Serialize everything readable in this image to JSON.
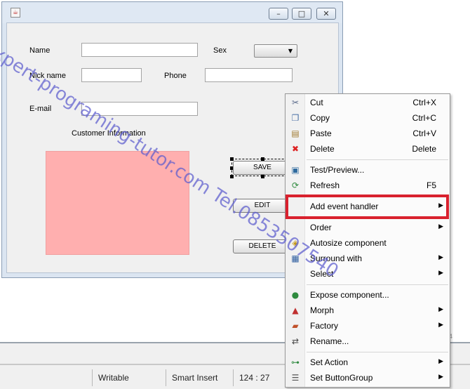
{
  "frame": {
    "labels": {
      "name": "Name",
      "sex": "Sex",
      "nickname": "Nick name",
      "phone": "Phone",
      "email": "E-mail",
      "customer_info": "Customer Information"
    },
    "buttons": {
      "save": "SAVE",
      "edit": "EDIT",
      "delete": "DELETE"
    },
    "photo_color": "#ffafaf"
  },
  "context_menu": {
    "items": [
      {
        "icon": "scissors-icon",
        "label": "Cut",
        "shortcut": "Ctrl+X"
      },
      {
        "icon": "copy-icon",
        "label": "Copy",
        "shortcut": "Ctrl+C"
      },
      {
        "icon": "paste-icon",
        "label": "Paste",
        "shortcut": "Ctrl+V"
      },
      {
        "icon": "delete-x-icon",
        "label": "Delete",
        "shortcut": "Delete"
      },
      {
        "icon": "preview-icon",
        "label": "Test/Preview...",
        "shortcut": ""
      },
      {
        "icon": "refresh-icon",
        "label": "Refresh",
        "shortcut": "F5"
      },
      {
        "icon": "",
        "label": "Add event handler",
        "shortcut": "",
        "submenu": true
      },
      {
        "icon": "",
        "label": "Order",
        "shortcut": "",
        "submenu": true
      },
      {
        "icon": "autosize-icon",
        "label": "Autosize component",
        "shortcut": ""
      },
      {
        "icon": "surround-icon",
        "label": "Surround with",
        "shortcut": "",
        "submenu": true
      },
      {
        "icon": "",
        "label": "Select",
        "shortcut": "",
        "submenu": true
      },
      {
        "icon": "expose-component-icon",
        "label": "Expose component...",
        "shortcut": ""
      },
      {
        "icon": "morph-icon",
        "label": "Morph",
        "shortcut": "",
        "submenu": true
      },
      {
        "icon": "factory-icon",
        "label": "Factory",
        "shortcut": "",
        "submenu": true
      },
      {
        "icon": "rename-icon",
        "label": "Rename...",
        "shortcut": ""
      },
      {
        "icon": "set-action-icon",
        "label": "Set Action",
        "shortcut": "",
        "submenu": true
      },
      {
        "icon": "button-group-icon",
        "label": "Set ButtonGroup",
        "shortcut": "",
        "submenu": true
      }
    ],
    "highlight_color": "#d9212e"
  },
  "status_bar": {
    "writable": "Writable",
    "insert_mode": "Smart Insert",
    "position": "124 : 27"
  },
  "corner_number": "4",
  "watermark": "expert-programing-tutor.com Tel.0853507540"
}
